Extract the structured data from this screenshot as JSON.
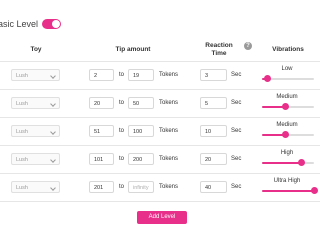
{
  "header": {
    "title": "asic Level",
    "toggle_on": true
  },
  "columns": {
    "toy": "Toy",
    "tip_amount": "Tip amount",
    "reaction_time": "Reaction Time",
    "help_icon_glyph": "?",
    "vibrations": "Vibrations"
  },
  "row_labels": {
    "to": "to",
    "tokens": "Tokens",
    "sec": "Sec"
  },
  "rows": [
    {
      "toy": "Lush",
      "from": "2",
      "to": "19",
      "to_placeholder": "",
      "time": "3",
      "vibration": "Low",
      "level": 0.1
    },
    {
      "toy": "Lush",
      "from": "20",
      "to": "50",
      "to_placeholder": "",
      "time": "5",
      "vibration": "Medium",
      "level": 0.45
    },
    {
      "toy": "Lush",
      "from": "51",
      "to": "100",
      "to_placeholder": "",
      "time": "10",
      "vibration": "Medium",
      "level": 0.45
    },
    {
      "toy": "Lush",
      "from": "101",
      "to": "200",
      "to_placeholder": "",
      "time": "20",
      "vibration": "High",
      "level": 0.75
    },
    {
      "toy": "Lush",
      "from": "201",
      "to": "",
      "to_placeholder": "infinity",
      "time": "40",
      "vibration": "Ultra High",
      "level": 1.0
    }
  ],
  "actions": {
    "add_level": "Add Level"
  },
  "colors": {
    "accent": "#e8308a"
  }
}
